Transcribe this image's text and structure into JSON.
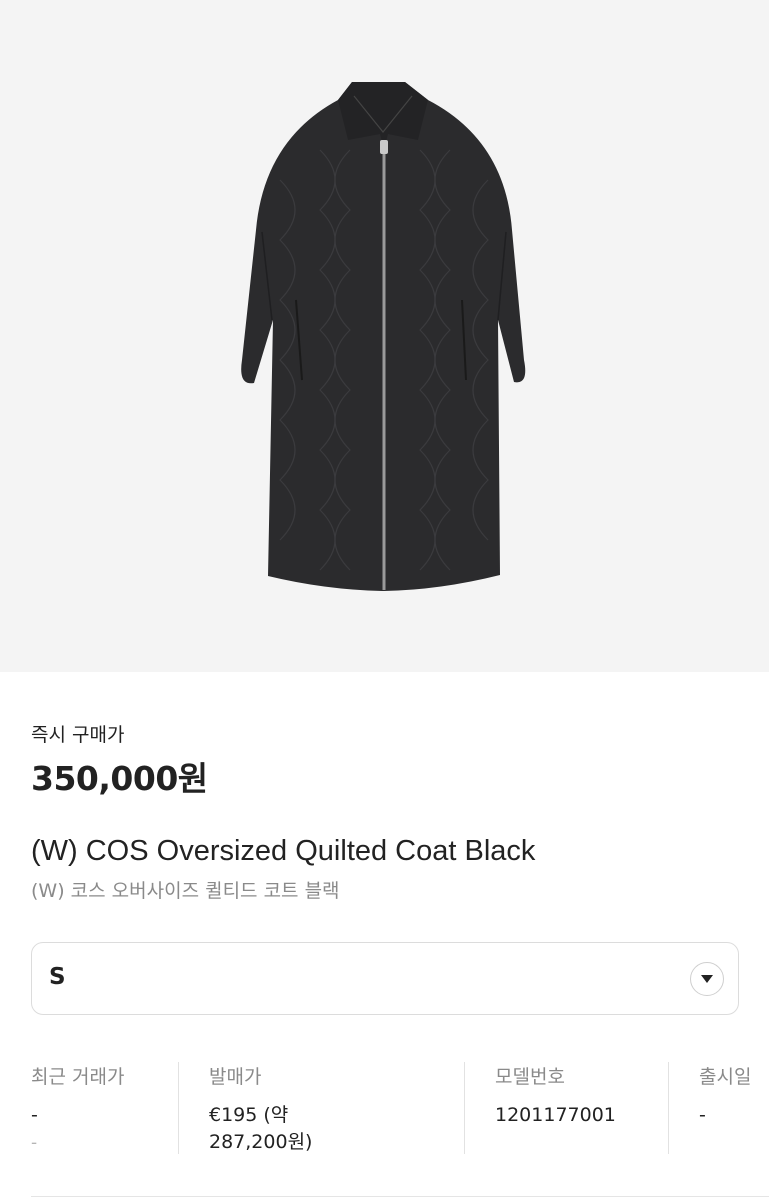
{
  "product": {
    "image_alt": "black quilted long coat",
    "price_label": "즉시 구매가",
    "price": "350,000원",
    "title_en": "(W) COS Oversized Quilted Coat Black",
    "title_ko": "(W) 코스 오버사이즈 퀼티드 코트 블랙"
  },
  "size_select": {
    "value": "S",
    "icon": "chevron-down-icon"
  },
  "info": {
    "recent_trade": {
      "label": "최근 거래가",
      "value": "-",
      "sub": "-"
    },
    "release_price": {
      "label": "발매가",
      "value_line1": "€195 (약",
      "value_line2": "287,200원)"
    },
    "model_number": {
      "label": "모델번호",
      "value": "1201177001"
    },
    "release_date": {
      "label": "출시일",
      "value": "-"
    }
  },
  "colors": {
    "background": "#f4f4f4",
    "coat": "#2b2b2d",
    "text_primary": "#222222",
    "text_secondary": "#8a8a8a"
  }
}
